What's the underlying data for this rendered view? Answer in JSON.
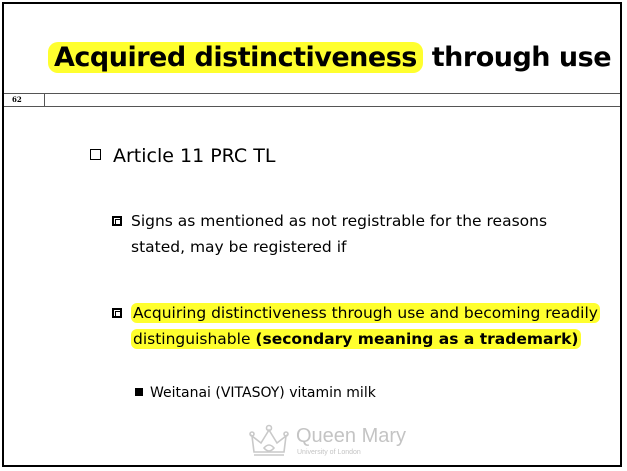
{
  "slide": {
    "title_highlighted": "Acquired distinctiveness",
    "title_rest": " through use",
    "page_number": "62",
    "bullet": "Article 11 PRC TL",
    "sub_bullets": [
      {
        "text": "Signs as mentioned as not registrable for the reasons stated, may be registered if"
      },
      {
        "text": "Acquiring distinctiveness through use and becoming readily distinguishable  ",
        "bold": "(secondary meaning as a trademark)"
      }
    ],
    "example": "Weitanai (VITASOY) vitamin milk",
    "logo": {
      "name": "Queen Mary",
      "subtitle": "University of London",
      "icon": "crown-icon"
    },
    "highlight_color": "#ffff2e"
  }
}
